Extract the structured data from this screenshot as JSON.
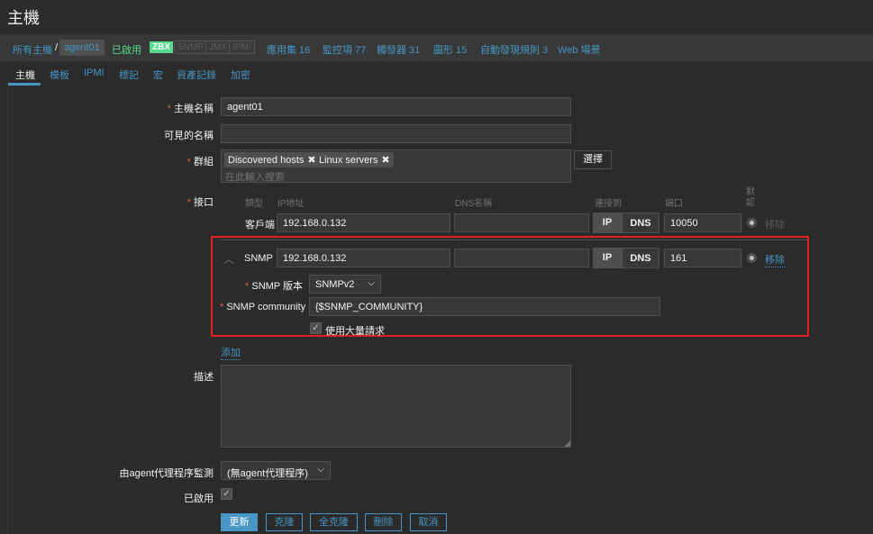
{
  "header": {
    "title": "主機"
  },
  "breadcrumb": {
    "all_hosts": "所有主機",
    "separator": "/",
    "current": "agent01",
    "status": "已啟用",
    "badges": {
      "zbx": "ZBX",
      "snmp": "SNMP",
      "jmx": "JMX",
      "ipmi": "IPMI"
    },
    "links": [
      "應用集 16",
      "監控項 77",
      "觸發器 31",
      "圖形 15",
      "自動發現規則 3",
      "Web 場景"
    ]
  },
  "tabs": [
    "主機",
    "模板",
    "IPMI",
    "標記",
    "宏",
    "資產記錄",
    "加密"
  ],
  "form": {
    "host_name": {
      "label": "主機名稱",
      "value": "agent01"
    },
    "visible_name": {
      "label": "可見的名稱",
      "value": ""
    },
    "groups": {
      "label": "群組",
      "chips": [
        "Discovered hosts",
        "Linux servers"
      ],
      "placeholder": "在此輸入搜索",
      "select_button": "選擇"
    },
    "interfaces": {
      "label": "接口",
      "headers": {
        "type": "類型",
        "ip": "IP地址",
        "dns": "DNS名稱",
        "connect": "連接到",
        "port": "端口",
        "default": "默認"
      },
      "agent": {
        "type": "客戶端",
        "ip": "192.168.0.132",
        "dns": "",
        "ip_btn": "IP",
        "dns_btn": "DNS",
        "port": "10050",
        "remove": "移除"
      },
      "snmp": {
        "type": "SNMP",
        "ip": "192.168.0.132",
        "dns": "",
        "ip_btn": "IP",
        "dns_btn": "DNS",
        "port": "161",
        "remove": "移除",
        "version_label": "SNMP 版本",
        "version": "SNMPv2",
        "community_label": "SNMP community",
        "community": "{$SNMP_COMMUNITY}",
        "bulk_label": "使用大量請求"
      },
      "add": "添加"
    },
    "description": {
      "label": "描述",
      "value": ""
    },
    "proxy": {
      "label": "由agent代理程序監測",
      "value": "(無agent代理程序)"
    },
    "enabled": {
      "label": "已啟用"
    },
    "buttons": {
      "update": "更新",
      "clone": "克隆",
      "full_clone": "全克隆",
      "delete": "刪除",
      "cancel": "取消"
    }
  },
  "colors": {
    "accent": "#4796c4",
    "enabled": "#59db8f",
    "required": "#e45959",
    "highlight_box": "#e02020"
  }
}
